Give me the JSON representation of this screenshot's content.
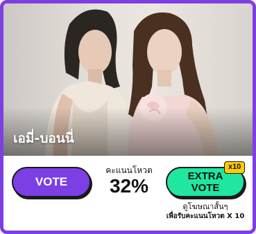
{
  "candidate": {
    "name": "เอมี่-บอนนี่",
    "photo_alt": "candidate-photo"
  },
  "vote_button": {
    "label": "VOTE"
  },
  "score": {
    "label": "คะแนนโหวต",
    "value": "32%"
  },
  "extra_vote": {
    "line1": "EXTRA",
    "line2": "VOTE",
    "badge": "x10",
    "note_line1": "ดูโฆษณาสั้นๆ",
    "note_line2": "เพื่อรับคะแนนโหวต X 10"
  },
  "colors": {
    "accent_purple": "#7b3fe4",
    "extra_green": "#1fe7a0",
    "badge_yellow": "#ffcc00"
  }
}
